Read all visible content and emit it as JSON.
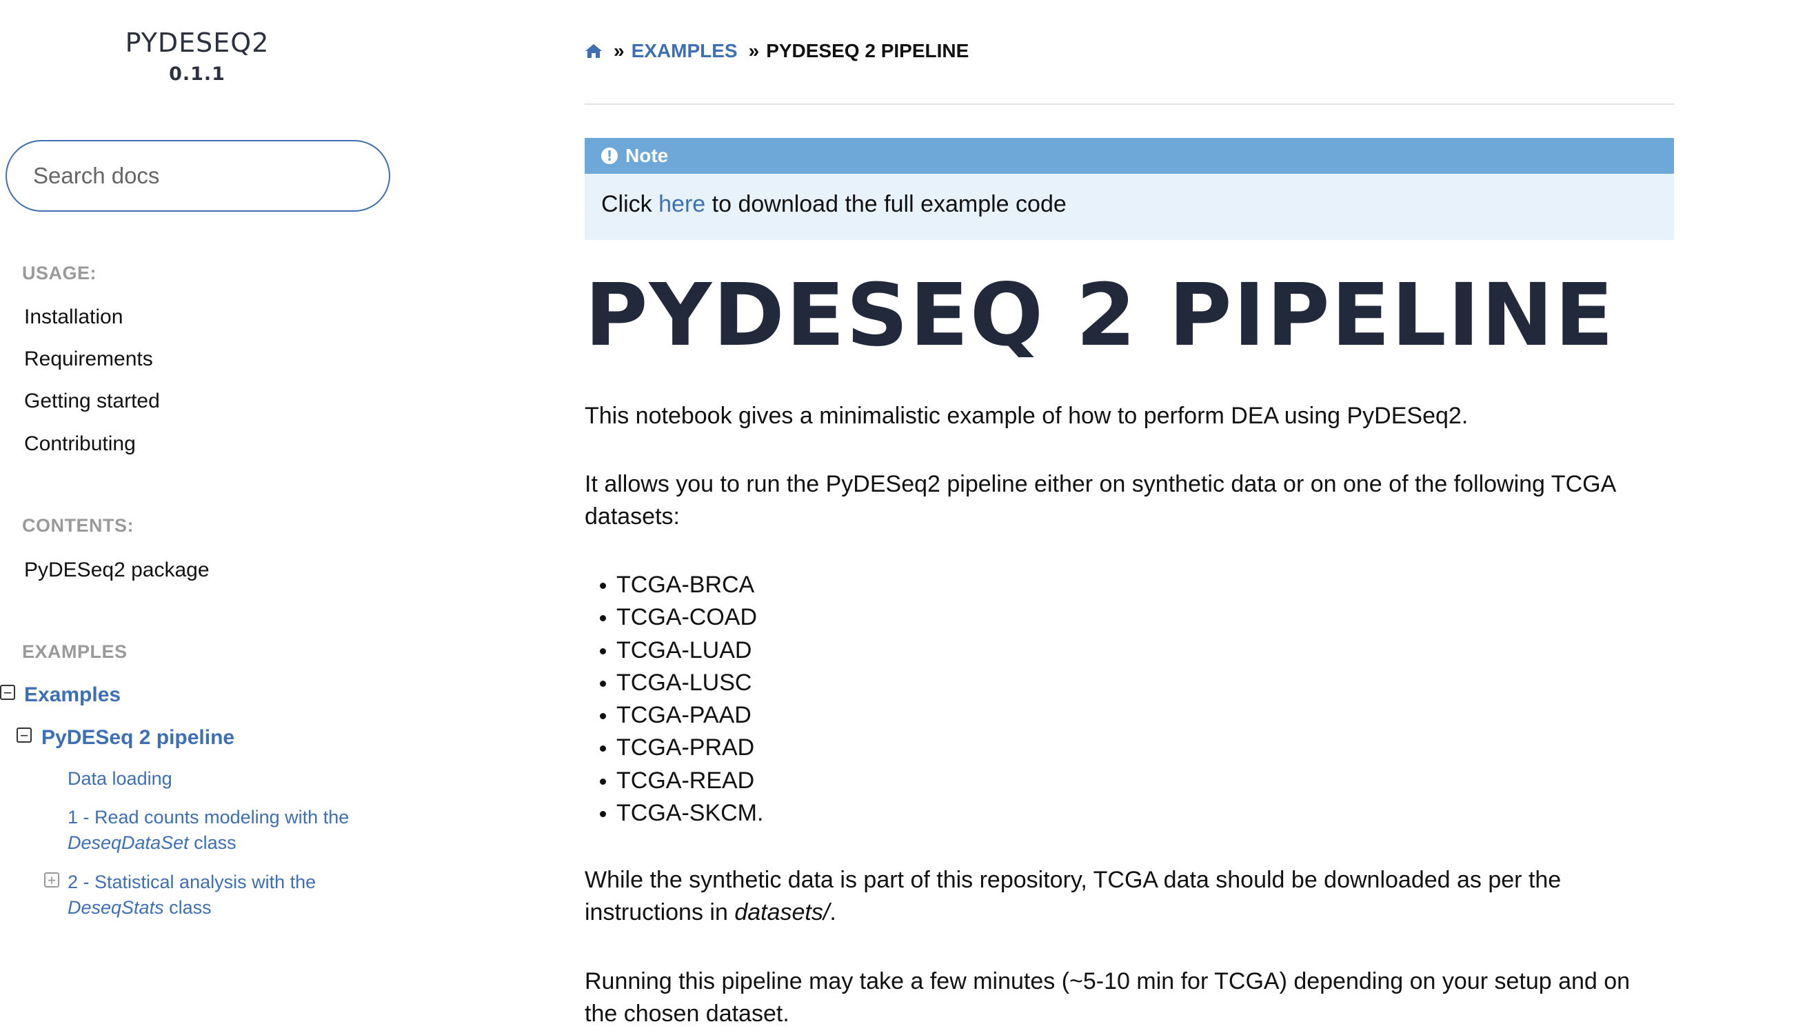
{
  "sidebar": {
    "brand": {
      "name": "PYDESEQ2",
      "version": "0.1.1"
    },
    "search": {
      "placeholder": "Search docs"
    },
    "usage": {
      "caption": "USAGE:",
      "items": [
        "Installation",
        "Requirements",
        "Getting started",
        "Contributing"
      ]
    },
    "contents": {
      "caption": "CONTENTS:",
      "items": [
        "PyDESeq2 package"
      ]
    },
    "examples": {
      "caption": "EXAMPLES",
      "tree": {
        "root": "Examples",
        "child": "PyDESeq 2 pipeline",
        "sub": {
          "data_loading": "Data loading",
          "read_counts_prefix": "1 - Read counts modeling with the",
          "read_counts_class": "DeseqDataSet",
          "read_counts_suffix": "class",
          "stats_prefix": "2 - Statistical analysis with the",
          "stats_class": "DeseqStats",
          "stats_suffix": "class"
        }
      }
    }
  },
  "main": {
    "breadcrumb": {
      "sep": "»",
      "examples": "EXAMPLES",
      "current": "PYDESEQ 2 PIPELINE"
    },
    "note": {
      "title": "Note",
      "click": "Click",
      "here": "here",
      "rest": "to download the full example code"
    },
    "title": "PYDESEQ 2 PIPELINE",
    "intro": "This notebook gives a minimalistic example of how to perform DEA using PyDESeq2.",
    "allows": "It allows you to run the PyDESeq2 pipeline either on synthetic data or on one of the following TCGA datasets:",
    "datasets": [
      "TCGA-BRCA",
      "TCGA-COAD",
      "TCGA-LUAD",
      "TCGA-LUSC",
      "TCGA-PAAD",
      "TCGA-PRAD",
      "TCGA-READ",
      "TCGA-SKCM."
    ],
    "synthetic_prefix": "While the synthetic data is part of this repository, TCGA data should be downloaded as per the instructions in",
    "synthetic_path": "datasets/",
    "synthetic_suffix": ".",
    "running": "Running this pipeline may take a few minutes (~5-10 min for TCGA) depending on your setup and on the chosen dataset."
  },
  "colors": {
    "link": "#3d6fb4",
    "note_header": "#6ea8d8",
    "note_body": "#e7f2fa",
    "title": "#22293a"
  }
}
